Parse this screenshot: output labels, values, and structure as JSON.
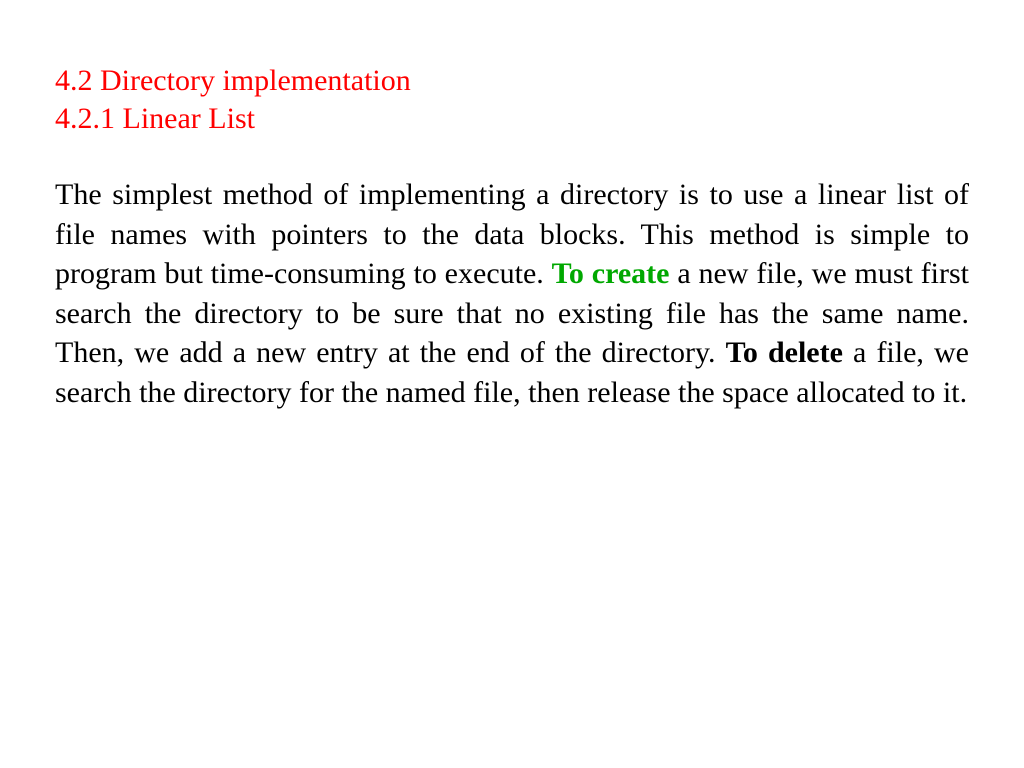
{
  "heading": {
    "main": "4.2 Directory implementation",
    "sub": "4.2.1 Linear List"
  },
  "body": {
    "p1": "The simplest method of implementing a directory is to use a linear list of file names with pointers to the data blocks. This method is simple to program but time-consuming to execute. ",
    "p2_highlight": "To create",
    "p3": " a new file, we must first search the directory to be sure that no existing file has the same name. Then, we add a new entry at the end of the directory. ",
    "p4_highlight": "To delete",
    "p5": " a file, we search the directory for the named file, then release the space allocated to it."
  }
}
